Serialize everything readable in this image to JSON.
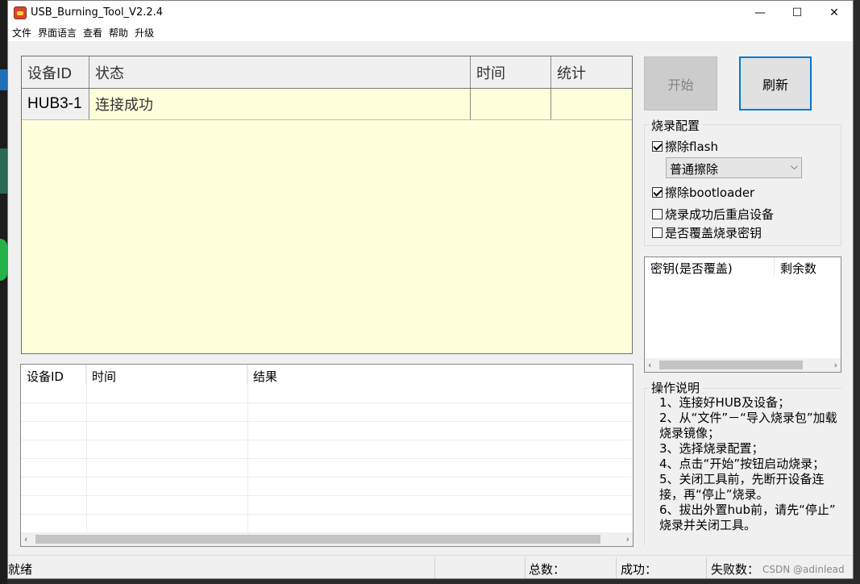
{
  "window": {
    "title": "USB_Burning_Tool_V2.2.4",
    "controls": {
      "minimize": "—",
      "maximize": "☐",
      "close": "✕"
    }
  },
  "menu": [
    "文件",
    "界面语言",
    "查看",
    "帮助",
    "升级"
  ],
  "device_grid": {
    "columns": [
      "设备ID",
      "状态",
      "时间",
      "统计"
    ],
    "rows": [
      {
        "id": "HUB3-1",
        "status": "连接成功",
        "time": "",
        "stats": ""
      }
    ],
    "background": "#fffedb"
  },
  "log_grid": {
    "columns": [
      "设备ID",
      "时间",
      "结果"
    ],
    "rows": []
  },
  "buttons": {
    "start_label": "开始",
    "refresh_label": "刷新",
    "start_enabled": false,
    "accent": "#0078d7"
  },
  "burn_config": {
    "title": "烧录配置",
    "erase_flash": {
      "label": "擦除flash",
      "checked": true
    },
    "erase_mode": {
      "selected": "普通擦除"
    },
    "erase_bootloader": {
      "label": "擦除bootloader",
      "checked": true
    },
    "reboot_after": {
      "label": "烧录成功后重启设备",
      "checked": false
    },
    "overwrite_key": {
      "label": "是否覆盖烧录密钥",
      "checked": false
    }
  },
  "key_list": {
    "columns": [
      "密钥(是否覆盖)",
      "剩余数"
    ]
  },
  "instructions": {
    "title": "操作说明",
    "lines": [
      "1、连接好HUB及设备；",
      "2、从“文件”－“导入烧录包”加载",
      "烧录镜像；",
      "3、选择烧录配置；",
      "4、点击“开始”按钮启动烧录；",
      "5、关闭工具前，先断开设备连",
      "接，再“停止”烧录。",
      "6、拔出外置hub前，请先“停止”",
      "烧录并关闭工具。"
    ]
  },
  "statusbar": {
    "status": "就绪",
    "total_label": "总数：",
    "success_label": "成功：",
    "fail_label": "失败数："
  },
  "watermark": "CSDN @adinlead"
}
